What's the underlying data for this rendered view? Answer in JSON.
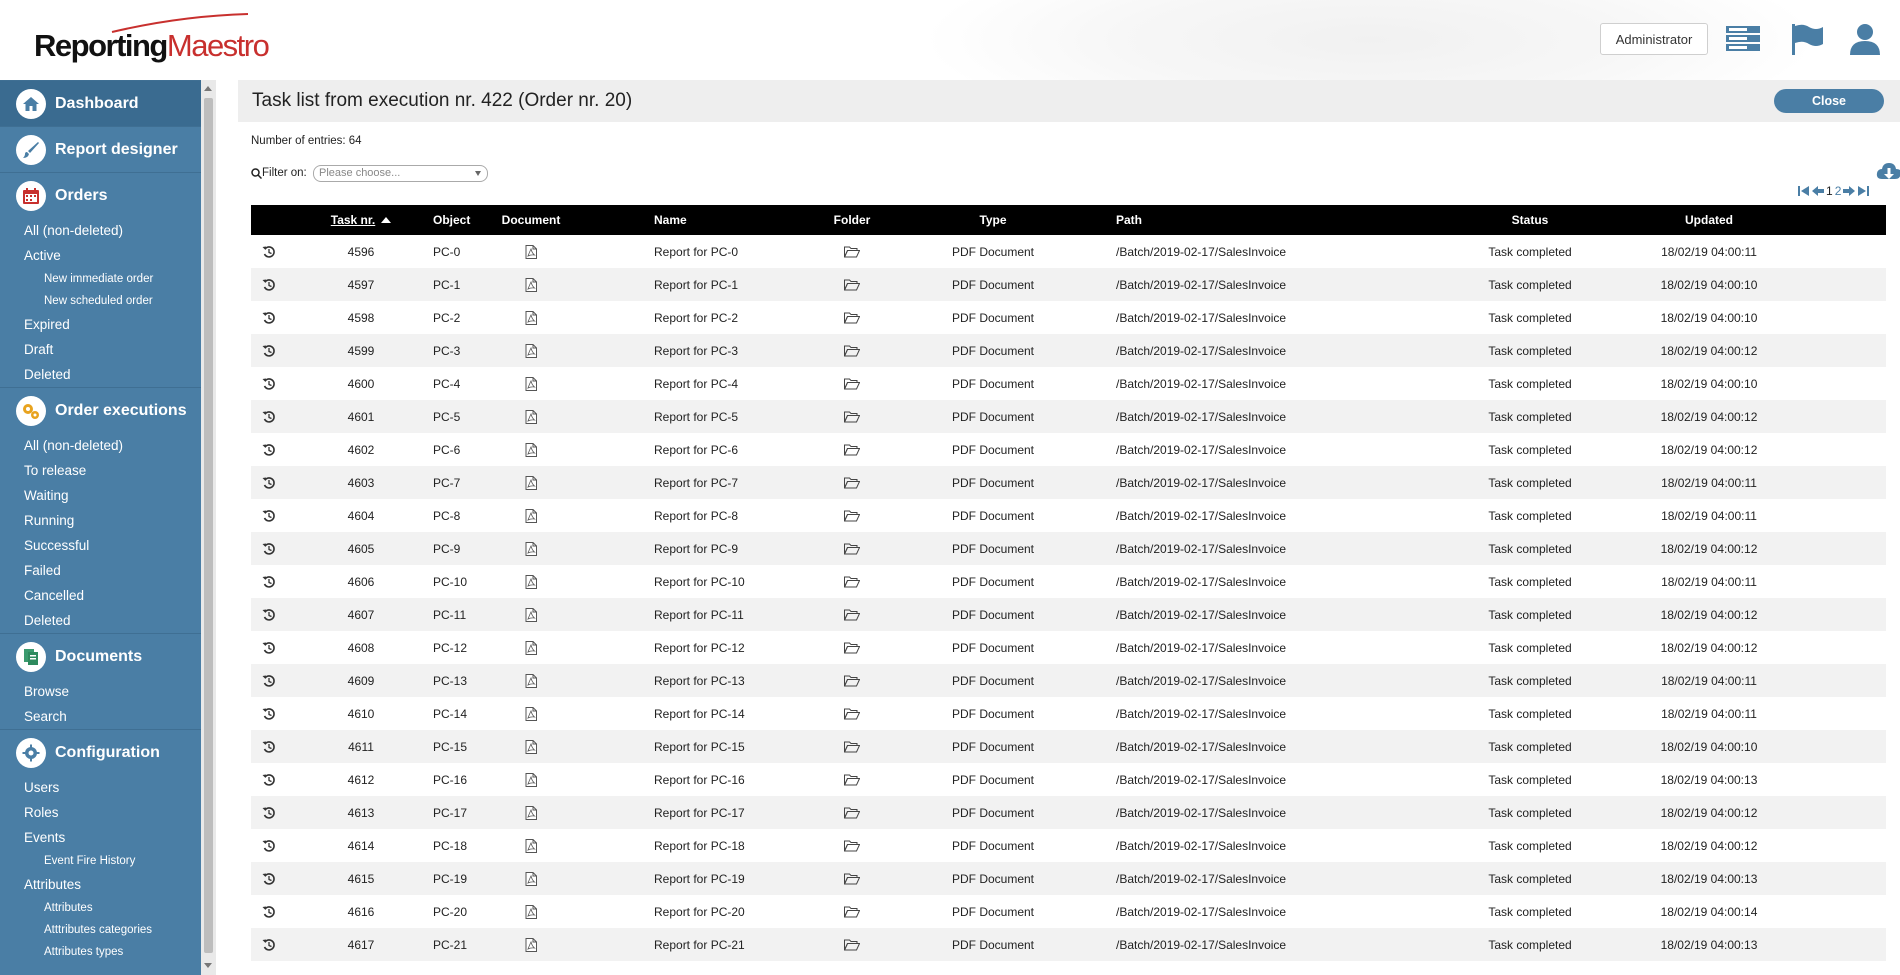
{
  "header": {
    "logo_part1": "Reporting",
    "logo_part2": "Maestro",
    "admin_label": "Administrator",
    "icons": [
      "server-icon",
      "flag-icon",
      "user-icon"
    ],
    "brand_color": "#c8302e"
  },
  "sidebar": {
    "sections": [
      {
        "label": "Dashboard",
        "icon": "home-icon",
        "items": []
      },
      {
        "label": "Report designer",
        "icon": "brush-icon",
        "items": []
      },
      {
        "label": "Orders",
        "icon": "calendar-icon",
        "items": [
          {
            "label": "All (non-deleted)",
            "level": 1
          },
          {
            "label": "Active",
            "level": 1
          },
          {
            "label": "New immediate order",
            "level": 2
          },
          {
            "label": "New scheduled order",
            "level": 2
          },
          {
            "label": "Expired",
            "level": 1
          },
          {
            "label": "Draft",
            "level": 1
          },
          {
            "label": "Deleted",
            "level": 1
          }
        ]
      },
      {
        "label": "Order executions",
        "icon": "gears-icon",
        "items": [
          {
            "label": "All (non-deleted)",
            "level": 1
          },
          {
            "label": "To release",
            "level": 1
          },
          {
            "label": "Waiting",
            "level": 1
          },
          {
            "label": "Running",
            "level": 1
          },
          {
            "label": "Successful",
            "level": 1
          },
          {
            "label": "Failed",
            "level": 1
          },
          {
            "label": "Cancelled",
            "level": 1
          },
          {
            "label": "Deleted",
            "level": 1
          }
        ]
      },
      {
        "label": "Documents",
        "icon": "documents-icon",
        "items": [
          {
            "label": "Browse",
            "level": 1
          },
          {
            "label": "Search",
            "level": 1
          }
        ]
      },
      {
        "label": "Configuration",
        "icon": "gear-icon",
        "items": [
          {
            "label": "Users",
            "level": 1
          },
          {
            "label": "Roles",
            "level": 1
          },
          {
            "label": "Events",
            "level": 1
          },
          {
            "label": "Event Fire History",
            "level": 2
          },
          {
            "label": "Attributes",
            "level": 1
          },
          {
            "label": "Attributes",
            "level": 2
          },
          {
            "label": "Atttributes categories",
            "level": 2
          },
          {
            "label": "Attributes types",
            "level": 2
          }
        ]
      }
    ],
    "color": "#4a7ea5"
  },
  "main": {
    "title": "Task list from execution nr. 422 (Order nr. 20)",
    "close_label": "Close",
    "entries_text": "Number of entries: 64",
    "filter_label": "Filter on:",
    "filter_placeholder": "Please choose...",
    "pager": {
      "page1": "1",
      "page2": "2"
    },
    "columns": {
      "task": "Task nr.",
      "object": "Object",
      "document": "Document",
      "name": "Name",
      "folder": "Folder",
      "type": "Type",
      "path": "Path",
      "status": "Status",
      "updated": "Updated"
    },
    "rows": [
      {
        "task": "4596",
        "object": "PC-0",
        "name": "Report for PC-0",
        "type": "PDF Document",
        "path": "/Batch/2019-02-17/SalesInvoice",
        "status": "Task completed",
        "updated": "18/02/19 04:00:11"
      },
      {
        "task": "4597",
        "object": "PC-1",
        "name": "Report for PC-1",
        "type": "PDF Document",
        "path": "/Batch/2019-02-17/SalesInvoice",
        "status": "Task completed",
        "updated": "18/02/19 04:00:10"
      },
      {
        "task": "4598",
        "object": "PC-2",
        "name": "Report for PC-2",
        "type": "PDF Document",
        "path": "/Batch/2019-02-17/SalesInvoice",
        "status": "Task completed",
        "updated": "18/02/19 04:00:10"
      },
      {
        "task": "4599",
        "object": "PC-3",
        "name": "Report for PC-3",
        "type": "PDF Document",
        "path": "/Batch/2019-02-17/SalesInvoice",
        "status": "Task completed",
        "updated": "18/02/19 04:00:12"
      },
      {
        "task": "4600",
        "object": "PC-4",
        "name": "Report for PC-4",
        "type": "PDF Document",
        "path": "/Batch/2019-02-17/SalesInvoice",
        "status": "Task completed",
        "updated": "18/02/19 04:00:10"
      },
      {
        "task": "4601",
        "object": "PC-5",
        "name": "Report for PC-5",
        "type": "PDF Document",
        "path": "/Batch/2019-02-17/SalesInvoice",
        "status": "Task completed",
        "updated": "18/02/19 04:00:12"
      },
      {
        "task": "4602",
        "object": "PC-6",
        "name": "Report for PC-6",
        "type": "PDF Document",
        "path": "/Batch/2019-02-17/SalesInvoice",
        "status": "Task completed",
        "updated": "18/02/19 04:00:12"
      },
      {
        "task": "4603",
        "object": "PC-7",
        "name": "Report for PC-7",
        "type": "PDF Document",
        "path": "/Batch/2019-02-17/SalesInvoice",
        "status": "Task completed",
        "updated": "18/02/19 04:00:11"
      },
      {
        "task": "4604",
        "object": "PC-8",
        "name": "Report for PC-8",
        "type": "PDF Document",
        "path": "/Batch/2019-02-17/SalesInvoice",
        "status": "Task completed",
        "updated": "18/02/19 04:00:11"
      },
      {
        "task": "4605",
        "object": "PC-9",
        "name": "Report for PC-9",
        "type": "PDF Document",
        "path": "/Batch/2019-02-17/SalesInvoice",
        "status": "Task completed",
        "updated": "18/02/19 04:00:12"
      },
      {
        "task": "4606",
        "object": "PC-10",
        "name": "Report for PC-10",
        "type": "PDF Document",
        "path": "/Batch/2019-02-17/SalesInvoice",
        "status": "Task completed",
        "updated": "18/02/19 04:00:11"
      },
      {
        "task": "4607",
        "object": "PC-11",
        "name": "Report for PC-11",
        "type": "PDF Document",
        "path": "/Batch/2019-02-17/SalesInvoice",
        "status": "Task completed",
        "updated": "18/02/19 04:00:12"
      },
      {
        "task": "4608",
        "object": "PC-12",
        "name": "Report for PC-12",
        "type": "PDF Document",
        "path": "/Batch/2019-02-17/SalesInvoice",
        "status": "Task completed",
        "updated": "18/02/19 04:00:12"
      },
      {
        "task": "4609",
        "object": "PC-13",
        "name": "Report for PC-13",
        "type": "PDF Document",
        "path": "/Batch/2019-02-17/SalesInvoice",
        "status": "Task completed",
        "updated": "18/02/19 04:00:11"
      },
      {
        "task": "4610",
        "object": "PC-14",
        "name": "Report for PC-14",
        "type": "PDF Document",
        "path": "/Batch/2019-02-17/SalesInvoice",
        "status": "Task completed",
        "updated": "18/02/19 04:00:11"
      },
      {
        "task": "4611",
        "object": "PC-15",
        "name": "Report for PC-15",
        "type": "PDF Document",
        "path": "/Batch/2019-02-17/SalesInvoice",
        "status": "Task completed",
        "updated": "18/02/19 04:00:10"
      },
      {
        "task": "4612",
        "object": "PC-16",
        "name": "Report for PC-16",
        "type": "PDF Document",
        "path": "/Batch/2019-02-17/SalesInvoice",
        "status": "Task completed",
        "updated": "18/02/19 04:00:13"
      },
      {
        "task": "4613",
        "object": "PC-17",
        "name": "Report for PC-17",
        "type": "PDF Document",
        "path": "/Batch/2019-02-17/SalesInvoice",
        "status": "Task completed",
        "updated": "18/02/19 04:00:12"
      },
      {
        "task": "4614",
        "object": "PC-18",
        "name": "Report for PC-18",
        "type": "PDF Document",
        "path": "/Batch/2019-02-17/SalesInvoice",
        "status": "Task completed",
        "updated": "18/02/19 04:00:12"
      },
      {
        "task": "4615",
        "object": "PC-19",
        "name": "Report for PC-19",
        "type": "PDF Document",
        "path": "/Batch/2019-02-17/SalesInvoice",
        "status": "Task completed",
        "updated": "18/02/19 04:00:13"
      },
      {
        "task": "4616",
        "object": "PC-20",
        "name": "Report for PC-20",
        "type": "PDF Document",
        "path": "/Batch/2019-02-17/SalesInvoice",
        "status": "Task completed",
        "updated": "18/02/19 04:00:14"
      },
      {
        "task": "4617",
        "object": "PC-21",
        "name": "Report for PC-21",
        "type": "PDF Document",
        "path": "/Batch/2019-02-17/SalesInvoice",
        "status": "Task completed",
        "updated": "18/02/19 04:00:13"
      }
    ]
  }
}
